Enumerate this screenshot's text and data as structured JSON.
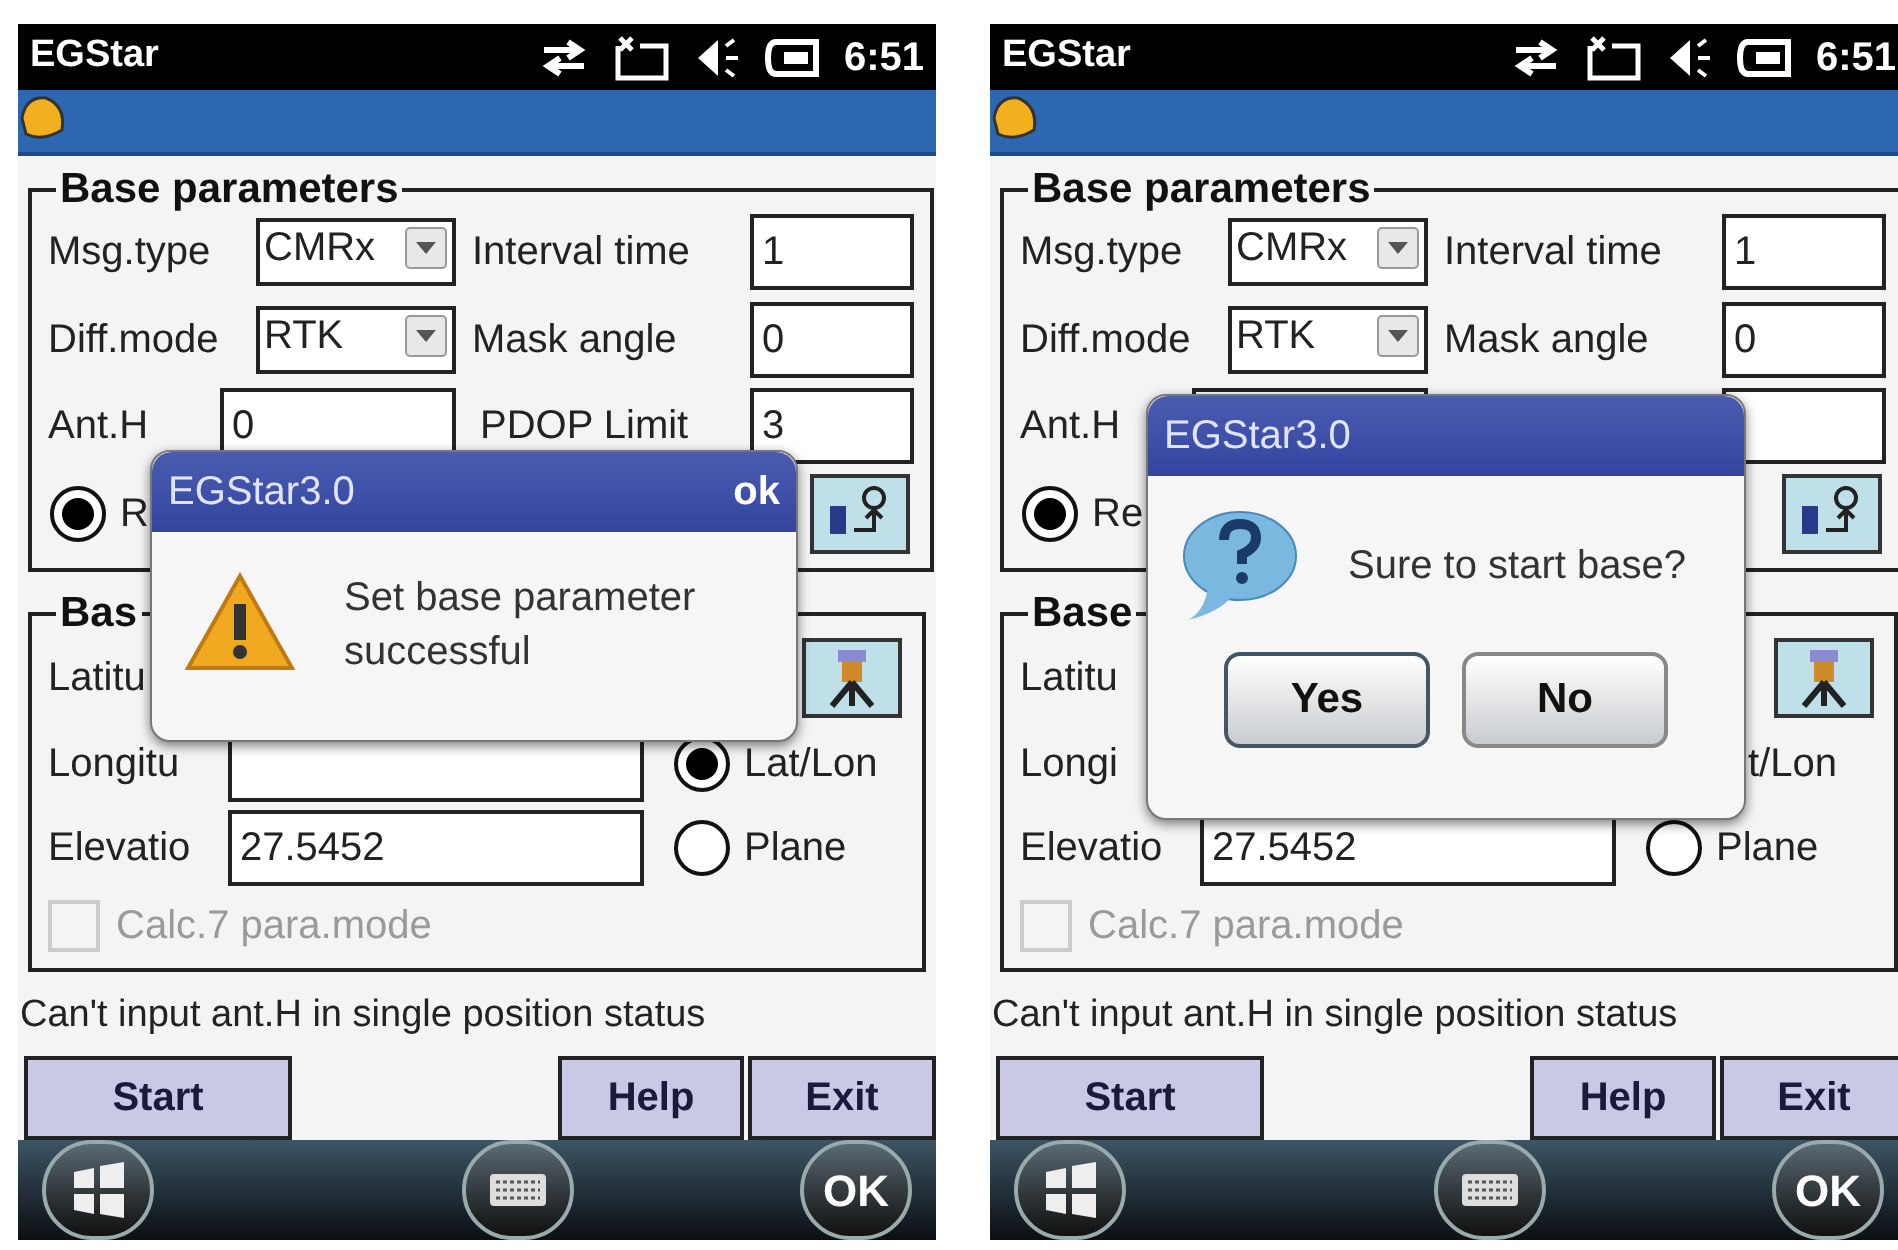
{
  "screens": [
    {
      "status_bar": {
        "app_name": "EGStar",
        "time": "6:51"
      },
      "base_parameters": {
        "title": "Base parameters",
        "msg_type": {
          "label": "Msg.type",
          "value": "CMRx"
        },
        "interval_time": {
          "label": "Interval time",
          "value": "1"
        },
        "diff_mode": {
          "label": "Diff.mode",
          "value": "RTK"
        },
        "mask_angle": {
          "label": "Mask angle",
          "value": "0"
        },
        "ant_h": {
          "label": "Ant.H",
          "value": "0"
        },
        "pdop_limit": {
          "label": "PDOP Limit",
          "value": "3"
        },
        "radio": {
          "label": "R",
          "selected": true
        }
      },
      "base_position": {
        "title": "Bas",
        "latitude_label": "Latitu",
        "longitude": {
          "label": "Longitu",
          "field_shown": true
        },
        "elevation": {
          "label": "Elevatio",
          "value": "27.5452"
        },
        "coord_options": [
          {
            "label": "Lat/Lon",
            "selected": true
          },
          {
            "label": "Plane",
            "selected": false
          }
        ],
        "calc_7_para_mode": {
          "label": "Calc.7 para.mode",
          "checked": false,
          "disabled": true
        }
      },
      "status_message": "Can't input ant.H in single position status",
      "buttons": [
        "Start",
        "Help",
        "Exit"
      ],
      "bottom_bar": {
        "ok_label": "OK"
      },
      "dialog": {
        "kind": "warning",
        "title": "EGStar3.0",
        "close": "ok",
        "message": "Set base parameter successful"
      }
    },
    {
      "status_bar": {
        "app_name": "EGStar",
        "time": "6:51"
      },
      "base_parameters": {
        "title": "Base parameters",
        "msg_type": {
          "label": "Msg.type",
          "value": "CMRx"
        },
        "interval_time": {
          "label": "Interval time",
          "value": "1"
        },
        "diff_mode": {
          "label": "Diff.mode",
          "value": "RTK"
        },
        "mask_angle": {
          "label": "Mask angle",
          "value": "0"
        },
        "ant_h": {
          "label": "Ant.H"
        },
        "radio": {
          "label": "Re",
          "selected": true
        }
      },
      "base_position": {
        "title": "Base",
        "latitude_label": "Latitu",
        "longitude": {
          "label": "Longi"
        },
        "elevation": {
          "label": "Elevatio",
          "value": "27.5452"
        },
        "coord_options": [
          {
            "label": "t/Lon"
          },
          {
            "label": "Plane",
            "selected": false
          }
        ],
        "calc_7_para_mode": {
          "label": "Calc.7 para.mode",
          "checked": false,
          "disabled": true
        }
      },
      "status_message": "Can't input ant.H in single position status",
      "buttons": [
        "Start",
        "Help",
        "Exit"
      ],
      "bottom_bar": {
        "ok_label": "OK"
      },
      "dialog": {
        "kind": "question",
        "title": "EGStar3.0",
        "message": "Sure to start base?",
        "buttons": [
          "Yes",
          "No"
        ]
      }
    }
  ]
}
